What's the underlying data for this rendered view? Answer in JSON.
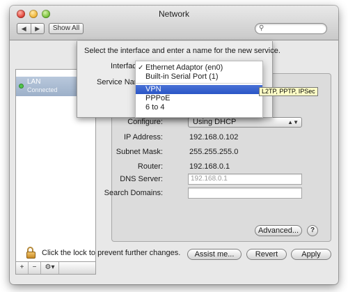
{
  "window": {
    "title": "Network"
  },
  "toolbar": {
    "back_label": "◀",
    "forward_label": "▶",
    "show_all_label": "Show All",
    "search_placeholder": ""
  },
  "sidebar": {
    "items": [
      {
        "name": "LAN",
        "status": "Connected",
        "status_color": "#4fc44a"
      }
    ],
    "add_label": "+",
    "remove_label": "−",
    "gear_label": "⚙▾"
  },
  "sheet": {
    "prompt": "Select the interface and enter a name for the new service.",
    "interface_label": "Interface",
    "service_name_label": "Service Name",
    "menu_items": [
      {
        "label": "Ethernet Adaptor (en0)",
        "checked": true
      },
      {
        "label": "Built-in Serial Port (1)"
      },
      {
        "label": "VPN",
        "highlighted": true
      },
      {
        "label": "PPPoE"
      },
      {
        "label": "6 to 4"
      }
    ],
    "tooltip": "L2TP, PPTP, IPSec"
  },
  "details": {
    "configure_label": "Configure:",
    "configure_value": "Using DHCP",
    "ip_label": "IP Address:",
    "ip_value": "192.168.0.102",
    "subnet_label": "Subnet Mask:",
    "subnet_value": "255.255.255.0",
    "router_label": "Router:",
    "router_value": "192.168.0.1",
    "dns_label": "DNS Server:",
    "dns_placeholder": "192.168.0.1",
    "search_domains_label": "Search Domains:",
    "advanced_label": "Advanced...",
    "help_label": "?"
  },
  "footer": {
    "lock_text": "Click the lock to prevent further changes.",
    "assist_label": "Assist me...",
    "revert_label": "Revert",
    "apply_label": "Apply"
  }
}
